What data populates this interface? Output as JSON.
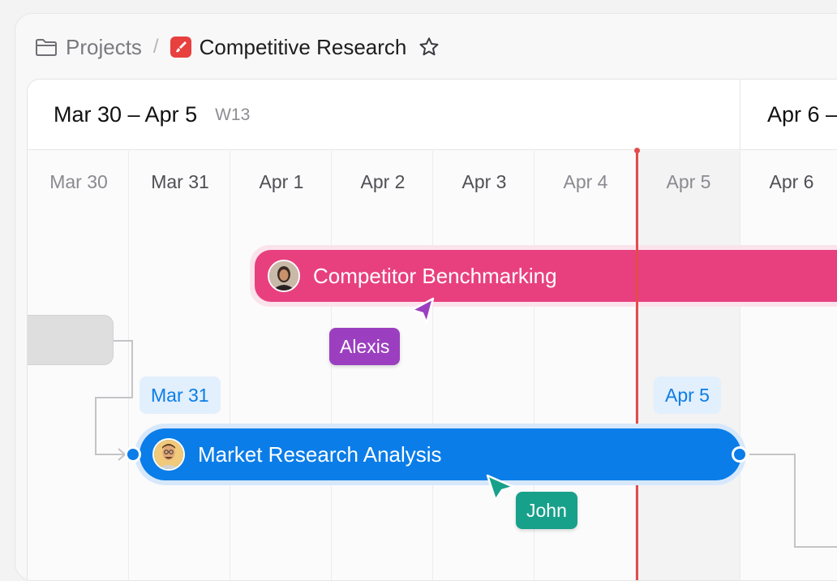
{
  "breadcrumb": {
    "parent": "Projects",
    "separator": "/",
    "current": "Competitive Research"
  },
  "week_headers": [
    {
      "range": "Mar 30 – Apr 5",
      "week": "W13"
    },
    {
      "range": "Apr 6 –",
      "week": ""
    }
  ],
  "days": [
    "Mar 30",
    "Mar 31",
    "Apr 1",
    "Apr 2",
    "Apr 3",
    "Apr 4",
    "Apr 5",
    "Apr 6"
  ],
  "tasks": {
    "benchmark": {
      "title": "Competitor Benchmarking",
      "color": "#e8407e"
    },
    "market": {
      "title": "Market Research Analysis",
      "color": "#0a7de8",
      "start_chip": "Mar 31",
      "end_chip": "Apr 5"
    }
  },
  "cursors": {
    "alexis": {
      "name": "Alexis",
      "color": "#9b3fc0"
    },
    "john": {
      "name": "John",
      "color": "#17a08a"
    }
  },
  "icons": {
    "folder": "folder-icon",
    "project": "brush-icon",
    "star": "star-icon"
  },
  "colors": {
    "today_line": "#e34c4c",
    "accent_blue": "#0a7de8",
    "accent_pink": "#e8407e"
  }
}
